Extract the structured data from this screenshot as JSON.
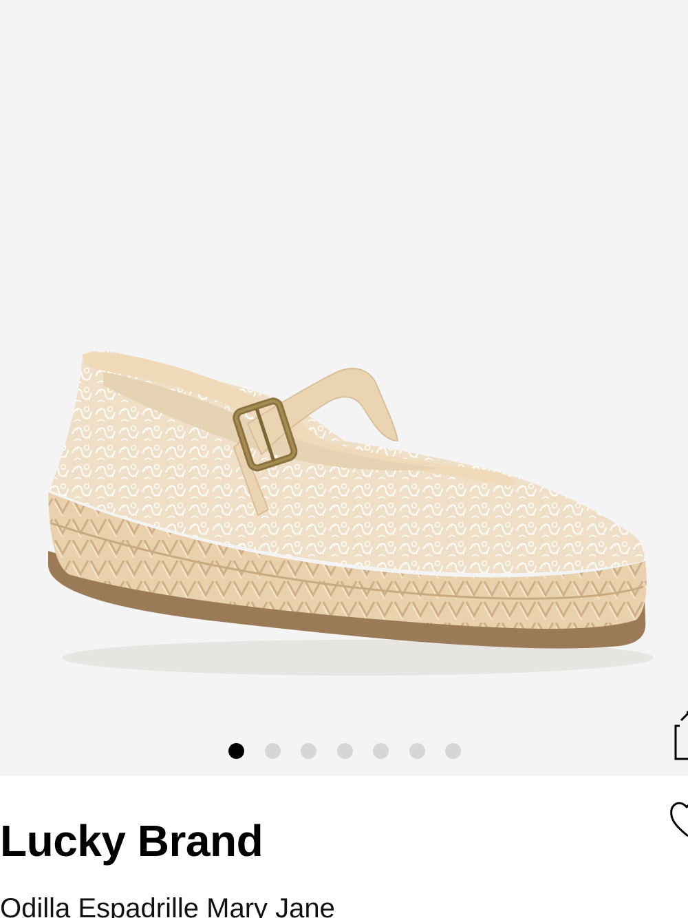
{
  "product": {
    "brand": "Lucky Brand",
    "name": "Odilla Espadrille Mary Jane",
    "image_alt": "Odilla Espadrille Mary Jane"
  },
  "gallery": {
    "image_count": 7,
    "active_index": 0,
    "active_dot_color": "#000000",
    "inactive_dot_color": "#d6d6d6",
    "background_color": "#f4f4f4"
  },
  "icons": {
    "share": "share-icon",
    "favorite": "heart-icon"
  }
}
